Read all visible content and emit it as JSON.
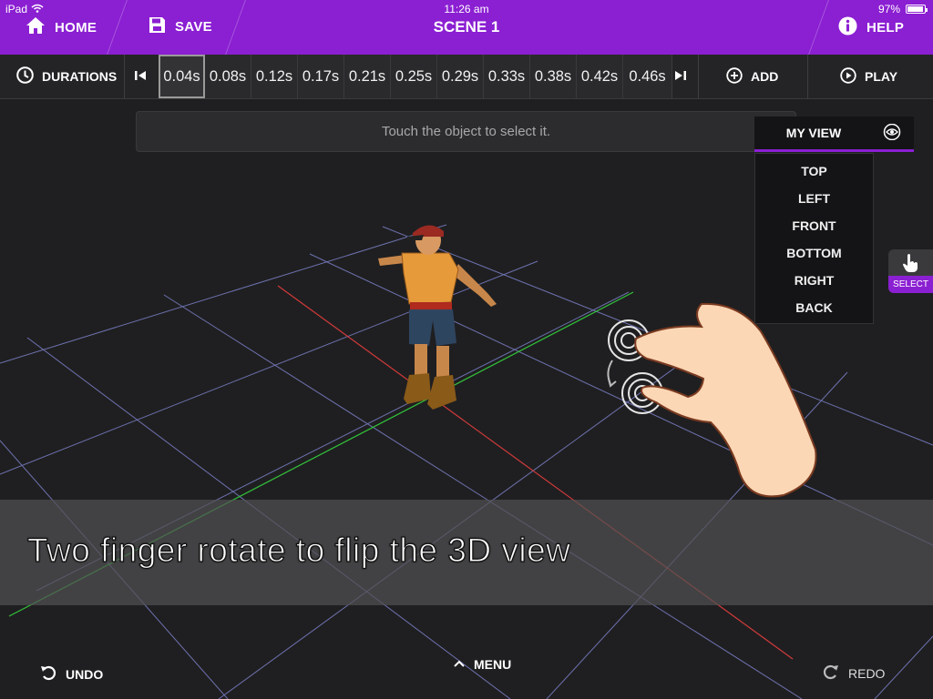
{
  "status": {
    "device": "iPad",
    "time": "11:26 am",
    "battery": "97%",
    "battery_fraction": 0.97
  },
  "topbar": {
    "home_label": "HOME",
    "save_label": "SAVE",
    "title": "SCENE 1",
    "help_label": "HELP",
    "accent": "#8b1fd2"
  },
  "toolbar": {
    "durations_label": "DURATIONS",
    "durations": [
      "0.04s",
      "0.08s",
      "0.12s",
      "0.17s",
      "0.21s",
      "0.25s",
      "0.29s",
      "0.33s",
      "0.38s",
      "0.42s",
      "0.46s"
    ],
    "selected_duration": "0.04s",
    "add_label": "ADD",
    "play_label": "PLAY"
  },
  "hint": {
    "text": "Touch the object to select it."
  },
  "view_menu": {
    "current": "MY VIEW",
    "items": [
      "TOP",
      "LEFT",
      "FRONT",
      "BOTTOM",
      "RIGHT",
      "BACK"
    ]
  },
  "select_tool": {
    "label": "SELECT"
  },
  "banner": {
    "text": "Two finger rotate  to flip the 3D view"
  },
  "bottom": {
    "undo_label": "UNDO",
    "menu_label": "MENU",
    "redo_label": "REDO"
  }
}
